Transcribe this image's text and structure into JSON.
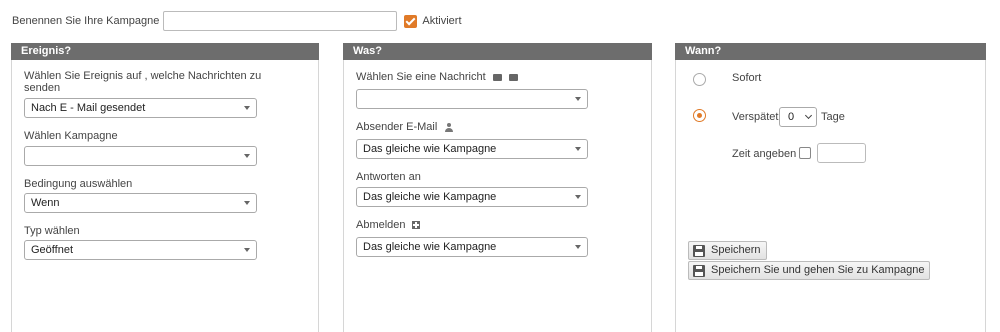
{
  "campaign": {
    "name_label": "Benennen Sie Ihre Kampagne",
    "name_value": "",
    "active_label": "Aktiviert",
    "active_checked": true
  },
  "colors": {
    "accent": "#e07a28",
    "panel_header": "#6d6d6d"
  },
  "event_panel": {
    "title": "Ereignis?",
    "event_label": "Wählen Sie Ereignis auf , welche Nachrichten zu senden",
    "event_value": "Nach E - Mail gesendet",
    "campaign_label": "Wählen Kampagne",
    "campaign_value": "",
    "condition_label": "Bedingung auswählen",
    "condition_value": "Wenn",
    "type_label": "Typ wählen",
    "type_value": "Geöffnet"
  },
  "what_panel": {
    "title": "Was?",
    "message_label": "Wählen Sie eine Nachricht",
    "message_value": "",
    "sender_label": "Absender E-Mail",
    "sender_value": "Das gleiche wie Kampagne",
    "reply_label": "Antworten an",
    "reply_value": "Das gleiche wie Kampagne",
    "unsub_label": "Abmelden",
    "unsub_value": "Das gleiche wie Kampagne"
  },
  "when_panel": {
    "title": "Wann?",
    "immediately_label": "Sofort",
    "delayed_label": "Verspätet",
    "delay_value": "0",
    "days_label": "Tage",
    "specify_time_label": "Zeit angeben",
    "time_value": "",
    "save_label": "Speichern",
    "save_and_go_label": "Speichern Sie und gehen Sie zu Kampagne"
  }
}
